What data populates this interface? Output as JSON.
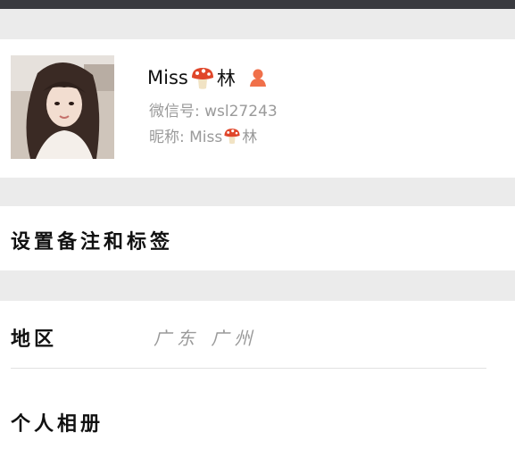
{
  "profile": {
    "name_prefix": "Miss",
    "name_suffix": "林",
    "wechat_id": "微信号: wsl27243",
    "nickname_prefix": "昵称: Miss",
    "nickname_suffix": "林",
    "icons": [
      "mushroom-icon",
      "gender-female-icon"
    ]
  },
  "menu": {
    "remark_tags": "设置备注和标签",
    "region_label": "地区",
    "region_value": "广东 广州",
    "album_label": "个人相册"
  },
  "colors": {
    "top_bar": "#393a3f",
    "section_gap": "#ebebeb",
    "secondary_text": "#9a9a9a",
    "gender_icon": "#f0704a"
  }
}
